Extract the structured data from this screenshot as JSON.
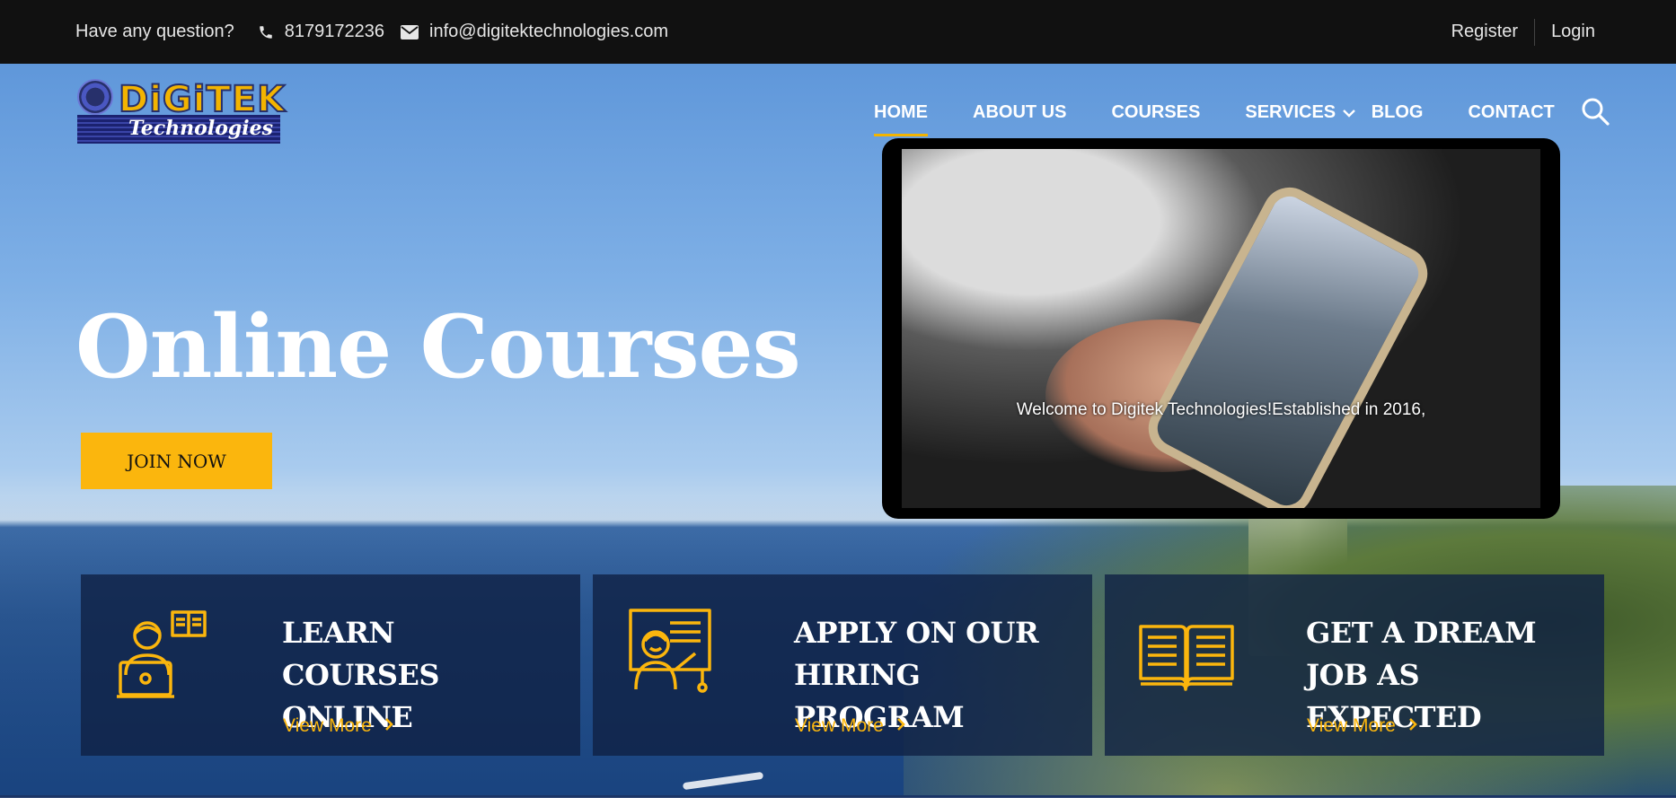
{
  "topbar": {
    "question": "Have any question?",
    "phone": "8179172236",
    "email": "info@digitektechnologies.com",
    "register": "Register",
    "login": "Login"
  },
  "logo": {
    "word": "DiGiTEK",
    "sub": "Technologies"
  },
  "nav": {
    "items": [
      {
        "label": "HOME",
        "active": true
      },
      {
        "label": "ABOUT US"
      },
      {
        "label": "COURSES"
      },
      {
        "label": "SERVICES",
        "dropdown": true
      },
      {
        "label": "BLOG"
      },
      {
        "label": "CONTACT"
      }
    ]
  },
  "hero": {
    "title": "Online Courses",
    "cta": "JOIN NOW"
  },
  "video": {
    "caption": "Welcome to Digitek Technologies!Established in 2016,"
  },
  "cards": [
    {
      "title": "LEARN COURSES ONLINE",
      "link": "View More",
      "icon": "laptop-learner-icon"
    },
    {
      "title": "APPLY ON OUR HIRING PROGRAM",
      "link": "View More",
      "icon": "presenter-board-icon"
    },
    {
      "title": "GET A DREAM JOB AS EXPECTED",
      "link": "View More",
      "icon": "open-book-icon"
    }
  ],
  "colors": {
    "accent": "#fbb60d",
    "topbar": "#111111",
    "card": "#0f2144"
  }
}
